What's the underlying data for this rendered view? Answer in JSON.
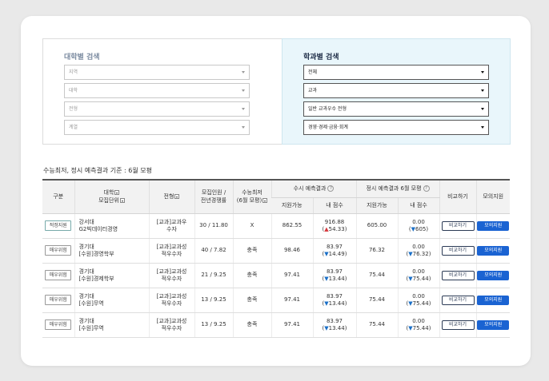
{
  "univ_search": {
    "title": "대학별 검색",
    "selects": [
      "지역",
      "대학",
      "전형",
      "계열"
    ]
  },
  "dept_search": {
    "title": "학과별 검색",
    "selects": [
      "전체",
      "교과",
      "일반 교과우수 전형",
      "경영·경제·금융·회계"
    ]
  },
  "basis_text": "수능최저, 정시 예측결과 기준 : 6월 모평",
  "table": {
    "headers": {
      "type": "구분",
      "univ": "대학",
      "unit": "모집단위",
      "track": "전형",
      "quota_a": "모집인원 /",
      "quota_b": "전년경쟁률",
      "min_a": "수능최저",
      "min_b": "(6월 모평)",
      "susi": "수시 예측결과",
      "jeongsi": "정시 예측결과 6월 모평",
      "compare": "비교하기",
      "mock": "모의지원",
      "susi_possible": "지원가능",
      "susi_score": "내 점수",
      "jeongsi_possible": "지원가능",
      "jeongsi_score": "내 점수"
    },
    "rows": [
      {
        "badge": "적정지원",
        "univ": "강서대",
        "unit": "G2빅데이터경영",
        "track_a": "[교과]교과우",
        "track_b": "수자",
        "quota": "30 / 11.80",
        "min": "X",
        "susi_possible": "862.55",
        "susi_score": "916.88",
        "susi_delta_arrow": "▲",
        "susi_delta": "54.33",
        "susi_dir": "up",
        "jeongsi_possible": "605.00",
        "jeongsi_score": "0.00",
        "jeongsi_delta_arrow": "▼",
        "jeongsi_delta": "605",
        "compare": "비교하기",
        "mock": "모의지원"
      },
      {
        "badge": "매우위험",
        "univ": "경기대",
        "unit": "[수원]경영학부",
        "track_a": "[교과]교과성",
        "track_b": "적우수자",
        "quota": "40 / 7.82",
        "min": "충족",
        "susi_possible": "98.46",
        "susi_score": "83.97",
        "susi_delta_arrow": "▼",
        "susi_delta": "14.49",
        "susi_dir": "down",
        "jeongsi_possible": "76.32",
        "jeongsi_score": "0.00",
        "jeongsi_delta_arrow": "▼",
        "jeongsi_delta": "76.32",
        "compare": "비교하기",
        "mock": "모의지원"
      },
      {
        "badge": "매우위험",
        "univ": "경기대",
        "unit": "[수원]경제학부",
        "track_a": "[교과]교과성",
        "track_b": "적우수자",
        "quota": "21 / 9.25",
        "min": "충족",
        "susi_possible": "97.41",
        "susi_score": "83.97",
        "susi_delta_arrow": "▼",
        "susi_delta": "13.44",
        "susi_dir": "down",
        "jeongsi_possible": "75.44",
        "jeongsi_score": "0.00",
        "jeongsi_delta_arrow": "▼",
        "jeongsi_delta": "75.44",
        "compare": "비교하기",
        "mock": "모의지원"
      },
      {
        "badge": "매우위험",
        "univ": "경기대",
        "unit": "[수원]무역",
        "track_a": "[교과]교과성",
        "track_b": "적우수자",
        "quota": "13 / 9.25",
        "min": "충족",
        "susi_possible": "97.41",
        "susi_score": "83.97",
        "susi_delta_arrow": "▼",
        "susi_delta": "13.44",
        "susi_dir": "down",
        "jeongsi_possible": "75.44",
        "jeongsi_score": "0.00",
        "jeongsi_delta_arrow": "▼",
        "jeongsi_delta": "75.44",
        "compare": "비교하기",
        "mock": "모의지원"
      },
      {
        "badge": "매우위험",
        "univ": "경기대",
        "unit": "[수원]무역",
        "track_a": "[교과]교과성",
        "track_b": "적우수자",
        "quota": "13 / 9.25",
        "min": "충족",
        "susi_possible": "97.41",
        "susi_score": "83.97",
        "susi_delta_arrow": "▼",
        "susi_delta": "13.44",
        "susi_dir": "down",
        "jeongsi_possible": "75.44",
        "jeongsi_score": "0.00",
        "jeongsi_delta_arrow": "▼",
        "jeongsi_delta": "75.44",
        "compare": "비교하기",
        "mock": "모의지원"
      }
    ]
  },
  "help_icon": "?",
  "colors": {
    "accent": "#1a63d2",
    "up": "#d6353b",
    "down": "#1a6fc7",
    "search_panel_bg": "#e9f6fb"
  }
}
